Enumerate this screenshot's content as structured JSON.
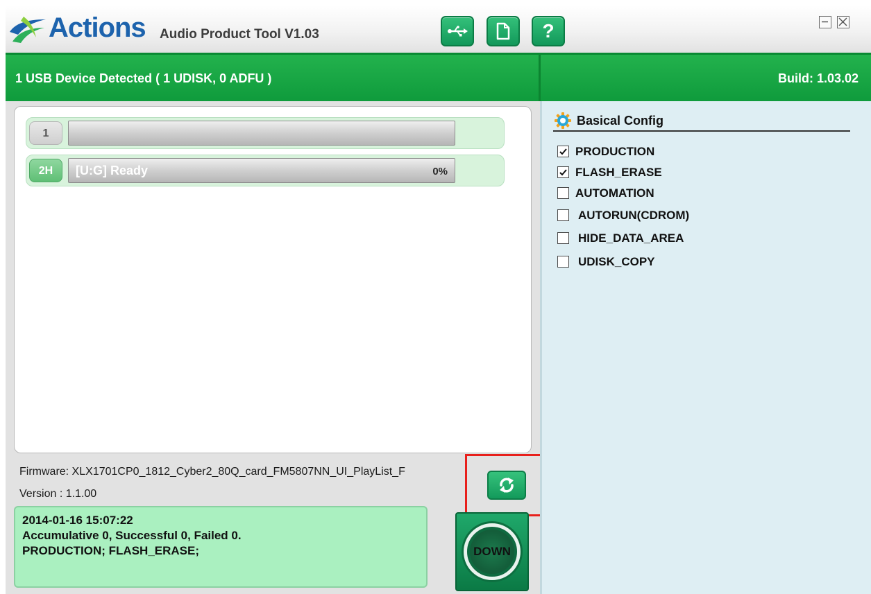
{
  "window": {
    "brand": "Actions",
    "title": "Audio Product Tool V1.03",
    "toolbar": {
      "usb_icon": "usb-icon",
      "file_icon": "document-icon",
      "help_icon": "help-question-icon",
      "help_glyph": "?"
    },
    "controls": {
      "minimize_icon": "minimize-icon",
      "close_icon": "close-icon"
    },
    "accent_color": "#1aa84a"
  },
  "status": {
    "devices_text": "1 USB Device Detected ( 1 UDISK, 0 ADFU )",
    "build_text": "Build: 1.03.02"
  },
  "devices": [
    {
      "badge": "1",
      "status_text": "",
      "percent": "",
      "progress": 0
    },
    {
      "badge": "2H",
      "status_text": "[U:G] Ready",
      "percent": "0%",
      "progress": 0
    }
  ],
  "firmware": {
    "label": "Firmware: XLX1701CP0_1812_Cyber2_80Q_card_FM5807NN_UI_PlayList_F",
    "version": "Version : 1.1.00"
  },
  "log": {
    "line1": "2014-01-16 15:07:22",
    "line2": "Accumulative 0, Successful 0, Failed 0.",
    "line3": "PRODUCTION; FLASH_ERASE;"
  },
  "down_button": {
    "label": "DOWN"
  },
  "config": {
    "title": "Basical Config",
    "items": [
      {
        "label": "PRODUCTION",
        "checked": true
      },
      {
        "label": "FLASH_ERASE",
        "checked": true
      },
      {
        "label": "AUTOMATION",
        "checked": false
      },
      {
        "label": "AUTORUN(CDROM)",
        "checked": false
      },
      {
        "label": "HIDE_DATA_AREA",
        "checked": false
      },
      {
        "label": "UDISK_COPY",
        "checked": false
      }
    ]
  }
}
